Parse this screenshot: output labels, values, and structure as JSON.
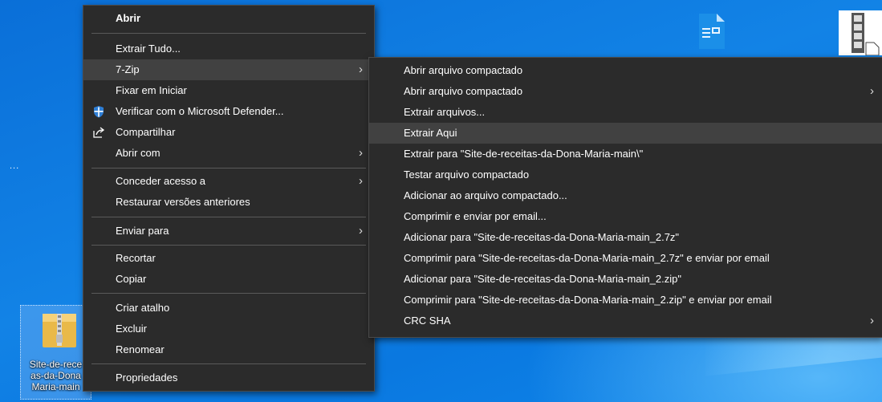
{
  "desktop": {
    "dots": "...",
    "zip_icon_label": "Site-de-rece\nas-da-Dona\nMaria-main"
  },
  "context_menu": {
    "items": [
      {
        "label": "Abrir",
        "bold": true
      },
      {
        "label": "Extrair Tudo..."
      },
      {
        "label": "7-Zip",
        "has_submenu": true
      },
      {
        "label": "Fixar em Iniciar"
      },
      {
        "label": "Verificar com o Microsoft Defender...",
        "icon": "defender-shield-icon"
      },
      {
        "label": "Compartilhar",
        "icon": "share-icon"
      },
      {
        "label": "Abrir com",
        "has_submenu": true
      },
      {
        "label": "Conceder acesso a",
        "has_submenu": true
      },
      {
        "label": "Restaurar versões anteriores"
      },
      {
        "label": "Enviar para",
        "has_submenu": true
      },
      {
        "label": "Recortar"
      },
      {
        "label": "Copiar"
      },
      {
        "label": "Criar atalho"
      },
      {
        "label": "Excluir"
      },
      {
        "label": "Renomear"
      },
      {
        "label": "Propriedades"
      }
    ],
    "arrow_glyph": "›"
  },
  "submenu_7zip": {
    "items": [
      {
        "label": "Abrir arquivo compactado"
      },
      {
        "label": "Abrir arquivo compactado",
        "has_submenu": true
      },
      {
        "label": "Extrair arquivos..."
      },
      {
        "label": "Extrair Aqui",
        "highlighted": true
      },
      {
        "label": "Extrair para \"Site-de-receitas-da-Dona-Maria-main\\\""
      },
      {
        "label": "Testar arquivo compactado"
      },
      {
        "label": "Adicionar ao arquivo compactado..."
      },
      {
        "label": "Comprimir e enviar por email..."
      },
      {
        "label": "Adicionar para \"Site-de-receitas-da-Dona-Maria-main_2.7z\""
      },
      {
        "label": "Comprimir para \"Site-de-receitas-da-Dona-Maria-main_2.7z\" e enviar por email"
      },
      {
        "label": "Adicionar para \"Site-de-receitas-da-Dona-Maria-main_2.zip\""
      },
      {
        "label": "Comprimir para \"Site-de-receitas-da-Dona-Maria-main_2.zip\" e enviar por email"
      },
      {
        "label": "CRC SHA",
        "has_submenu": true
      }
    ]
  },
  "colors": {
    "menu_bg": "#2b2b2b",
    "menu_highlight": "#414141",
    "desktop_blue": "#0a78e0",
    "defender_blue": "#2f7fd6"
  }
}
